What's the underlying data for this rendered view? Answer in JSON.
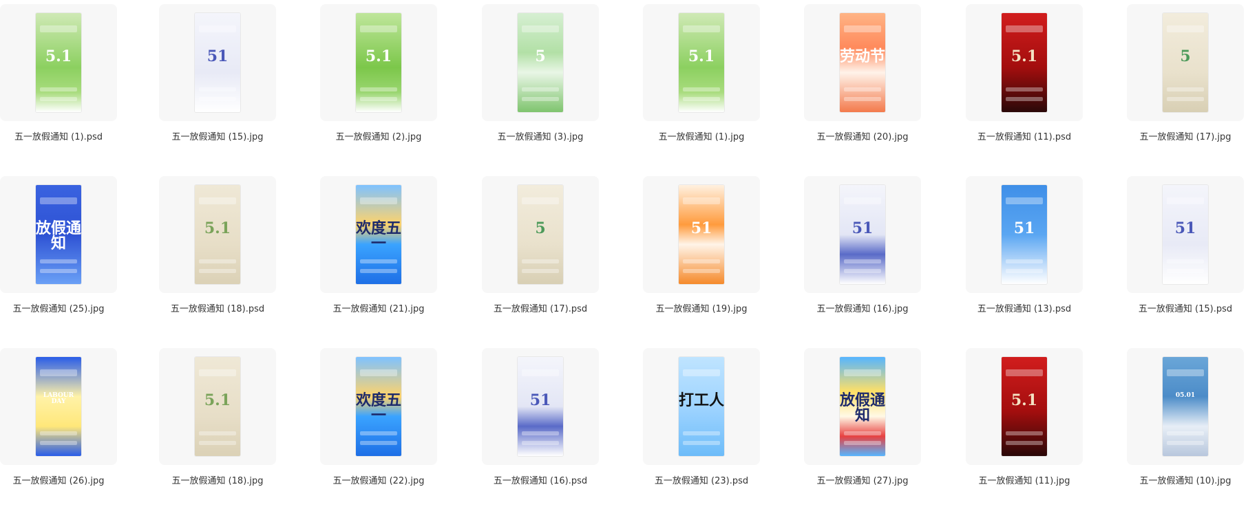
{
  "files": [
    {
      "name": "五一放假通知 (1).psd",
      "bg": "linear-gradient(180deg,#cfe9b5 0%,#8cd060 55%,#a9dc7e 80%,#ffffff 100%)",
      "mark": "5.1",
      "mark_color": "#ffffff"
    },
    {
      "name": "五一放假通知 (15).jpg",
      "bg": "linear-gradient(180deg,#f4f5fb 0%,#e8eaf6 60%,#ffffff 100%)",
      "mark": "51",
      "mark_color": "#4a58b8"
    },
    {
      "name": "五一放假通知 (2).jpg",
      "bg": "linear-gradient(180deg,#bfe69b 0%,#7cc74a 55%,#9ad670 80%,#ffffff 100%)",
      "mark": "5.1",
      "mark_color": "#ffffff"
    },
    {
      "name": "五一放假通知 (3).jpg",
      "bg": "linear-gradient(180deg,#d6efd2 0%,#b2e0a6 40%,#e9f6e6 60%,#7fc46e 100%)",
      "mark": "5",
      "mark_color": "#ffffff"
    },
    {
      "name": "五一放假通知 (1).jpg",
      "bg": "linear-gradient(180deg,#cfe9b5 0%,#8cd060 55%,#a9dc7e 80%,#ffffff 100%)",
      "mark": "5.1",
      "mark_color": "#ffffff"
    },
    {
      "name": "五一放假通知 (20).jpg",
      "bg": "linear-gradient(180deg,#ffb485 0%,#ff8a5c 35%,#fff3ea 60%,#f37a4c 100%)",
      "mark": "劳动节",
      "mark_color": "#ffffff"
    },
    {
      "name": "五一放假通知 (11).psd",
      "bg": "linear-gradient(180deg,#d11d1d 0%,#a30e0e 55%,#2a0808 100%)",
      "mark": "5.1",
      "mark_color": "#f4e2c3"
    },
    {
      "name": "五一放假通知 (17).jpg",
      "bg": "linear-gradient(180deg,#f2ecdc 0%,#e9e1cc 60%,#d8cfb4 100%)",
      "mark": "5",
      "mark_color": "#4d9a5a"
    },
    {
      "name": "五一放假通知 (25).jpg",
      "bg": "linear-gradient(180deg,#3a63e0 0%,#2e52d4 50%,#6aa0f6 100%)",
      "mark": "放假通知",
      "mark_color": "#ffffff"
    },
    {
      "name": "五一放假通知 (18).psd",
      "bg": "linear-gradient(180deg,#efe8d6 0%,#e7dec7 60%,#dbd1b6 100%)",
      "mark": "5.1",
      "mark_color": "#7aa35a"
    },
    {
      "name": "五一放假通知 (21).jpg",
      "bg": "linear-gradient(180deg,#7fc2ff 0%,#ffd36a 40%,#3aa3ff 60%,#1e6fe6 100%)",
      "mark": "欢度五一",
      "mark_color": "#1d2a6b"
    },
    {
      "name": "五一放假通知 (17).psd",
      "bg": "linear-gradient(180deg,#f2ecdc 0%,#e9e1cc 60%,#d8cfb4 100%)",
      "mark": "5",
      "mark_color": "#4d9a5a"
    },
    {
      "name": "五一放假通知 (19).jpg",
      "bg": "linear-gradient(180deg,#fff1e0 0%,#ff9b3d 40%,#fff4e8 60%,#f58a2b 100%)",
      "mark": "51",
      "mark_color": "#ffffff"
    },
    {
      "name": "五一放假通知 (16).jpg",
      "bg": "linear-gradient(180deg,#f4f5fb 0%,#e3e6f5 50%,#5a6bc8 70%,#ffffff 100%)",
      "mark": "51",
      "mark_color": "#4a58b8"
    },
    {
      "name": "五一放假通知 (13).psd",
      "bg": "linear-gradient(180deg,#3f8fe8 0%,#5aa6f2 50%,#cfe4fb 85%,#ffffff 100%)",
      "mark": "51",
      "mark_color": "#ffffff"
    },
    {
      "name": "五一放假通知 (15).psd",
      "bg": "linear-gradient(180deg,#f4f5fb 0%,#e8eaf6 60%,#ffffff 100%)",
      "mark": "51",
      "mark_color": "#4a58b8"
    },
    {
      "name": "五一放假通知 (26).jpg",
      "bg": "linear-gradient(180deg,#2a5de8 0%,#fff2a8 40%,#ffe77a 70%,#2a5de8 100%)",
      "mark": "LABOUR DAY",
      "mark_color": "#ffffff"
    },
    {
      "name": "五一放假通知 (18).jpg",
      "bg": "linear-gradient(180deg,#efe8d6 0%,#e7dec7 60%,#dbd1b6 100%)",
      "mark": "5.1",
      "mark_color": "#7aa35a"
    },
    {
      "name": "五一放假通知 (22).jpg",
      "bg": "linear-gradient(180deg,#7fc2ff 0%,#ffd36a 40%,#3aa3ff 60%,#1e6fe6 100%)",
      "mark": "欢度五一",
      "mark_color": "#1d2a6b"
    },
    {
      "name": "五一放假通知 (16).psd",
      "bg": "linear-gradient(180deg,#f4f5fb 0%,#e3e6f5 50%,#5a6bc8 70%,#ffffff 100%)",
      "mark": "51",
      "mark_color": "#4a58b8"
    },
    {
      "name": "五一放假通知 (23).psd",
      "bg": "linear-gradient(180deg,#bfe4ff 0%,#9fd4ff 50%,#6dbcf9 100%)",
      "mark": "打工人",
      "mark_color": "#111111"
    },
    {
      "name": "五一放假通知 (27).jpg",
      "bg": "linear-gradient(180deg,#56b5ff 0%,#ffe066 35%,#fff9e6 60%,#e84141 80%,#56b5ff 100%)",
      "mark": "放假通知",
      "mark_color": "#1d2a6b"
    },
    {
      "name": "五一放假通知 (11).jpg",
      "bg": "linear-gradient(180deg,#d11d1d 0%,#a30e0e 55%,#2a0808 100%)",
      "mark": "5.1",
      "mark_color": "#f4e2c3"
    },
    {
      "name": "五一放假通知 (10).jpg",
      "bg": "linear-gradient(180deg,#6aa6d8 0%,#4c8cc8 40%,#e7eef6 70%,#b8c7dd 100%)",
      "mark": "05.01",
      "mark_color": "#ffffff"
    }
  ]
}
